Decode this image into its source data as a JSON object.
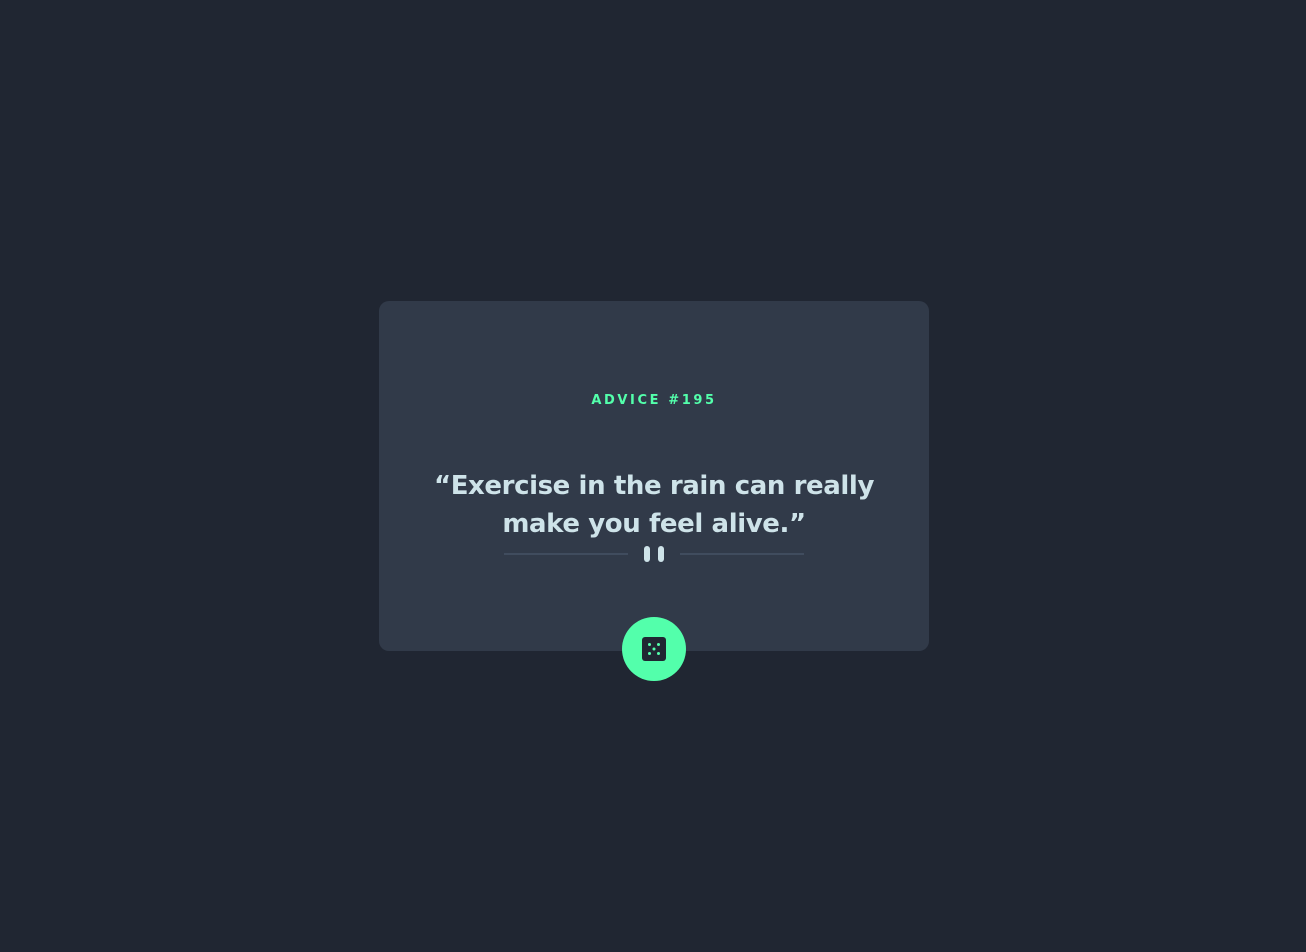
{
  "advice": {
    "number_label": "ADVICE #195",
    "quote": "“Exercise in the rain can really make you feel alive.”"
  },
  "icons": {
    "divider": "pause-divider-icon",
    "dice_button": "dice-icon"
  },
  "colors": {
    "background": "#202632",
    "card": "#313a49",
    "accent": "#53ffab",
    "quote_text": "#cee3e9",
    "divider_line": "#4f5d74"
  }
}
